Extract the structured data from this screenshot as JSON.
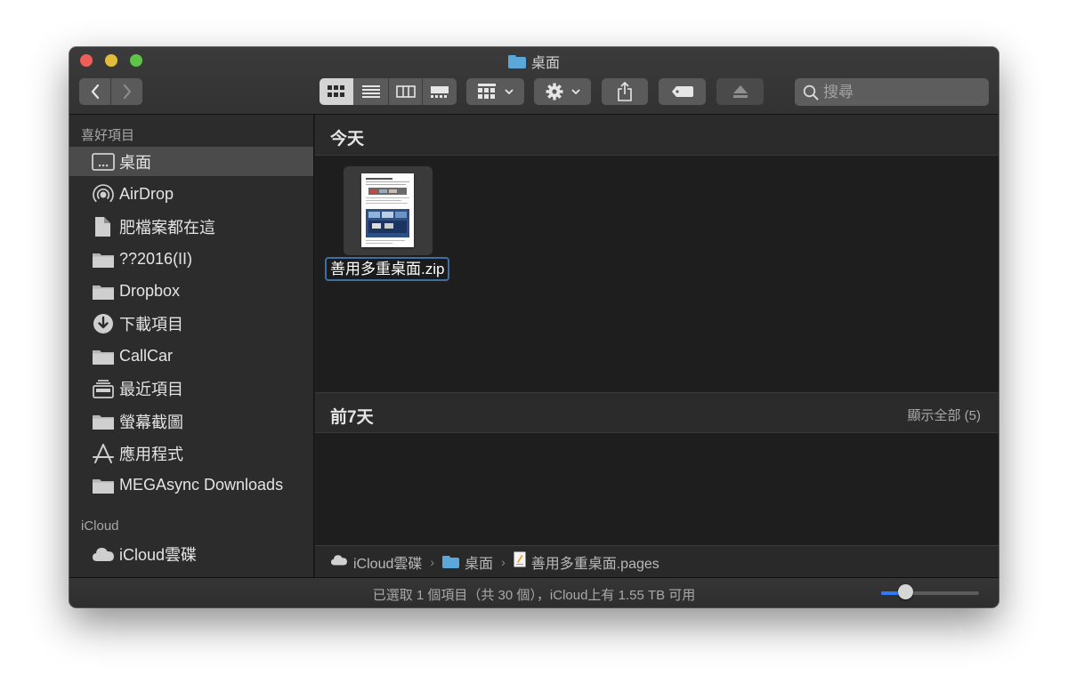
{
  "window": {
    "title": "桌面"
  },
  "toolbar": {
    "back_symbol": "‹",
    "forward_symbol": "›",
    "search_placeholder": "搜尋"
  },
  "sidebar": {
    "favorites_header": "喜好項目",
    "favorites": [
      {
        "label": "桌面",
        "icon": "desktop-icon",
        "selected": true
      },
      {
        "label": "AirDrop",
        "icon": "airdrop-icon"
      },
      {
        "label": "肥檔案都在這",
        "icon": "document-icon"
      },
      {
        "label": "??2016(II)",
        "icon": "folder-icon"
      },
      {
        "label": "Dropbox",
        "icon": "folder-icon"
      },
      {
        "label": "下載項目",
        "icon": "download-icon"
      },
      {
        "label": "CallCar",
        "icon": "folder-icon"
      },
      {
        "label": "最近項目",
        "icon": "recents-icon"
      },
      {
        "label": "螢幕截圖",
        "icon": "folder-icon"
      },
      {
        "label": "應用程式",
        "icon": "applications-icon"
      },
      {
        "label": "MEGAsync Downloads",
        "icon": "folder-icon"
      }
    ],
    "icloud_header": "iCloud",
    "icloud": [
      {
        "label": "iCloud雲碟",
        "icon": "cloud-icon"
      }
    ]
  },
  "main": {
    "groups": [
      {
        "title": "今天",
        "files": [
          {
            "name": "善用多重桌面.zip"
          }
        ]
      },
      {
        "title": "前7天",
        "show_all_label": "顯示全部 (5)"
      }
    ]
  },
  "pathbar": {
    "items": [
      {
        "label": "iCloud雲碟",
        "icon": "cloud-icon"
      },
      {
        "label": "桌面",
        "icon": "folder-icon"
      },
      {
        "label": "善用多重桌面.pages",
        "icon": "pages-file-icon"
      }
    ],
    "separator": "›"
  },
  "status": {
    "text": "已選取 1 個項目（共 30 個），iCloud上有 1.55 TB 可用",
    "icon_size_level": 0.25
  },
  "colors": {
    "accent": "#2f7bf6",
    "selection_outline": "#3f6ea3",
    "folder_blue": "#5aa7da"
  }
}
